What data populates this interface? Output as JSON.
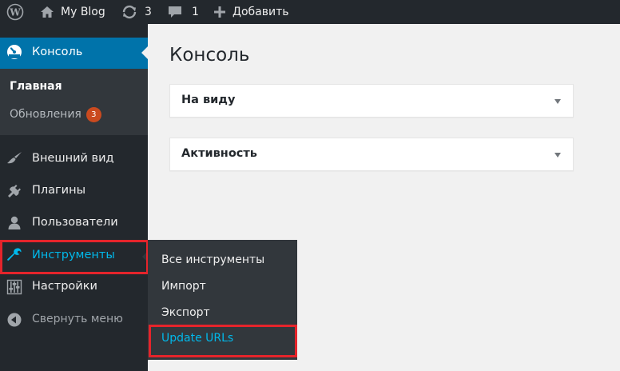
{
  "admin_bar": {
    "site_name": "My Blog",
    "updates_count": "3",
    "comments_count": "1",
    "add_new_label": "Добавить"
  },
  "sidebar": {
    "console": "Консоль",
    "console_sub": {
      "main": "Главная",
      "updates": "Обновления",
      "updates_badge": "3"
    },
    "appearance": "Внешний вид",
    "plugins": "Плагины",
    "users": "Пользователи",
    "tools": "Инструменты",
    "settings": "Настройки",
    "collapse": "Свернуть меню"
  },
  "tools_flyout": [
    "Все инструменты",
    "Импорт",
    "Экспорт",
    "Update URLs"
  ],
  "main": {
    "title": "Консоль",
    "widgets": [
      "На виду",
      "Активность"
    ]
  },
  "colors": {
    "adminbar_bg": "#23282d",
    "submenu_bg": "#32373c",
    "accent_blue": "#0073aa",
    "active_link": "#00b9eb",
    "highlight_red": "#e5242b",
    "badge": "#ca4a1f"
  },
  "icons": [
    "wordpress-logo-icon",
    "home-icon",
    "updates-icon",
    "comments-icon",
    "plus-icon",
    "dashboard-icon",
    "appearance-brush-icon",
    "plugins-icon",
    "users-icon",
    "tools-wrench-icon",
    "settings-icon",
    "collapse-arrow-icon",
    "chevron-down-icon"
  ]
}
